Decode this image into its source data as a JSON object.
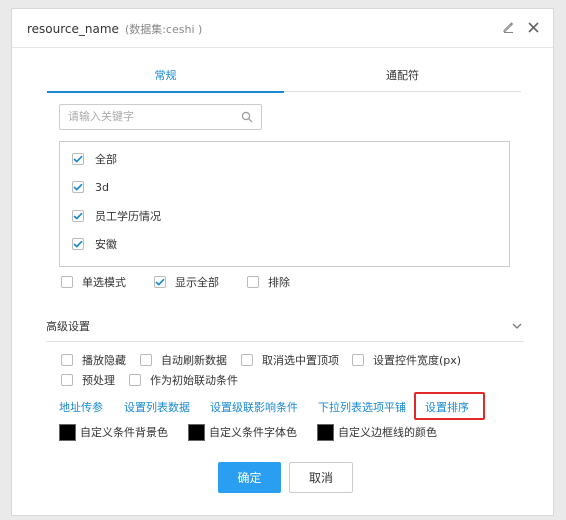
{
  "dialog": {
    "title": "resource_name",
    "subtitle": "(数据集:ceshi )"
  },
  "icons": {
    "edit": "pencil-icon",
    "close": "close-icon",
    "search": "search-icon",
    "section_toggle": "chevron-down-icon"
  },
  "tabs": [
    {
      "label": "常规",
      "active": true
    },
    {
      "label": "通配符",
      "active": false
    }
  ],
  "search": {
    "placeholder": "请输入关键字",
    "value": ""
  },
  "list_items": [
    {
      "label": "全部",
      "checked": true
    },
    {
      "label": "3d",
      "checked": true
    },
    {
      "label": "员工学历情况",
      "checked": true
    },
    {
      "label": "安徽",
      "checked": true
    }
  ],
  "options": [
    {
      "label": "单选模式",
      "checked": false
    },
    {
      "label": "显示全部",
      "checked": true
    },
    {
      "label": "排除",
      "checked": false
    }
  ],
  "advanced": {
    "title": "高级设置",
    "checkboxes": [
      {
        "label": "播放隐藏",
        "checked": false
      },
      {
        "label": "自动刷新数据",
        "checked": false
      },
      {
        "label": "取消选中置顶项",
        "checked": false
      },
      {
        "label": "设置控件宽度(px)",
        "checked": false
      },
      {
        "label": "预处理",
        "checked": false
      },
      {
        "label": "作为初始联动条件",
        "checked": false
      }
    ],
    "links": [
      "地址传参",
      "设置列表数据",
      "设置级联影响条件",
      "下拉列表选项平铺",
      "设置排序"
    ],
    "colors": [
      {
        "label": "自定义条件背景色",
        "color": "#000000"
      },
      {
        "label": "自定义条件字体色",
        "color": "#000000"
      },
      {
        "label": "自定义边框线的颜色",
        "color": "#000000"
      }
    ]
  },
  "buttons": {
    "confirm": "确定",
    "cancel": "取消"
  },
  "colors": {
    "accent": "#1a8ad0",
    "primary_button": "#2a9ef0",
    "highlight_border": "#e02a2a"
  }
}
